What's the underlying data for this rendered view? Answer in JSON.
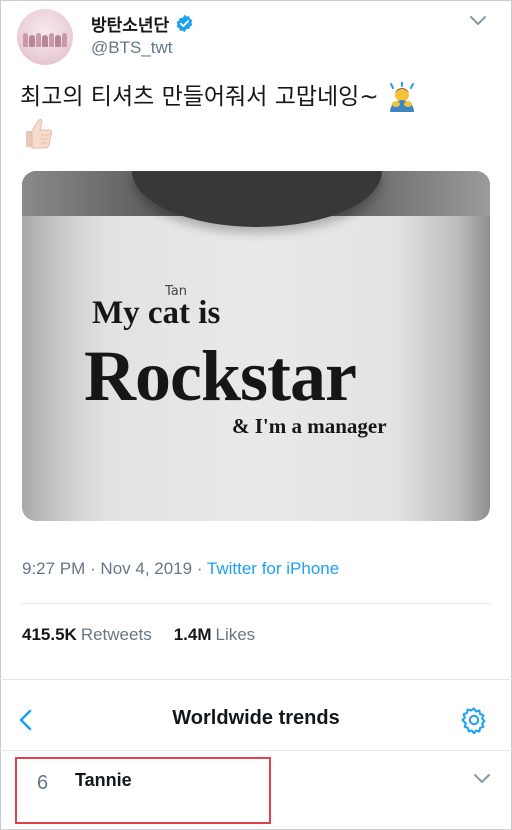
{
  "tweet": {
    "display_name": "방탄소년단",
    "handle": "@BTS_twt",
    "verified_icon": "verified-badge-icon",
    "menu_icon": "chevron-down-icon",
    "text": "최고의 티셔츠 만들어줘서 고맙네잉~",
    "emojis": [
      "man-bowing-emoji",
      "thumbs-up-emoji"
    ],
    "image": {
      "shirt_line1": "My cat is",
      "shirt_handwritten": "Tan",
      "shirt_line2": "Rockstar",
      "shirt_line3": "& I'm a manager"
    },
    "timestamp": "9:27 PM · Nov 4, 2019 · ",
    "source": "Twitter for iPhone",
    "retweets_count": "415.5K",
    "retweets_label": "Retweets",
    "likes_count": "1.4M",
    "likes_label": "Likes"
  },
  "trends": {
    "back_icon": "back-arrow-icon",
    "title": "Worldwide trends",
    "settings_icon": "gear-icon",
    "items": [
      {
        "rank": "6",
        "name": "Tannie"
      }
    ]
  },
  "colors": {
    "accent": "#1da1f2",
    "secondary_text": "#657786",
    "highlight_border": "#e0414a"
  }
}
